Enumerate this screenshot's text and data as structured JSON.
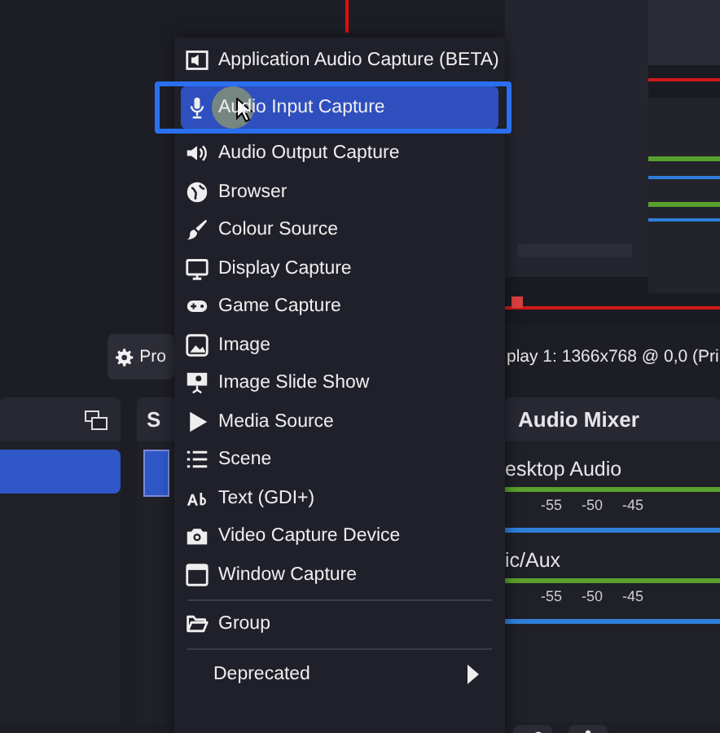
{
  "toolbar": {
    "properties_button": "Pro",
    "display_label": "play 1: 1366x768 @ 0,0 (Pri"
  },
  "scenes": {
    "items": [
      {
        "selected": true
      }
    ]
  },
  "sources": {
    "title": "S",
    "items": [
      {
        "selected": true
      }
    ]
  },
  "audio_mixer": {
    "title": "Audio Mixer",
    "channels": [
      {
        "name": "esktop Audio",
        "ticks": [
          "-55",
          "-50",
          "-45"
        ],
        "level": 1
      },
      {
        "name": "ic/Aux",
        "ticks": [
          "-55",
          "-50",
          "-45"
        ],
        "level": 1
      }
    ]
  },
  "add_source_menu": {
    "items": [
      {
        "kind": "item",
        "label": "Application Audio Capture (BETA)",
        "selected": false
      },
      {
        "kind": "item",
        "label": "Audio Input Capture",
        "selected": true
      },
      {
        "kind": "item",
        "label": "Audio Output Capture",
        "selected": false
      },
      {
        "kind": "item",
        "label": "Browser",
        "selected": false
      },
      {
        "kind": "item",
        "label": "Colour Source",
        "selected": false
      },
      {
        "kind": "item",
        "label": "Display Capture",
        "selected": false
      },
      {
        "kind": "item",
        "label": "Game Capture",
        "selected": false
      },
      {
        "kind": "item",
        "label": "Image",
        "selected": false
      },
      {
        "kind": "item",
        "label": "Image Slide Show",
        "selected": false
      },
      {
        "kind": "item",
        "label": "Media Source",
        "selected": false
      },
      {
        "kind": "item",
        "label": "Scene",
        "selected": false
      },
      {
        "kind": "item",
        "label": "Text (GDI+)",
        "selected": false
      },
      {
        "kind": "item",
        "label": "Video Capture Device",
        "selected": false
      },
      {
        "kind": "item",
        "label": "Window Capture",
        "selected": false
      },
      {
        "kind": "separator"
      },
      {
        "kind": "item",
        "label": "Group",
        "selected": false
      },
      {
        "kind": "separator"
      },
      {
        "kind": "submenu",
        "label": "Deprecated",
        "selected": false
      }
    ]
  }
}
